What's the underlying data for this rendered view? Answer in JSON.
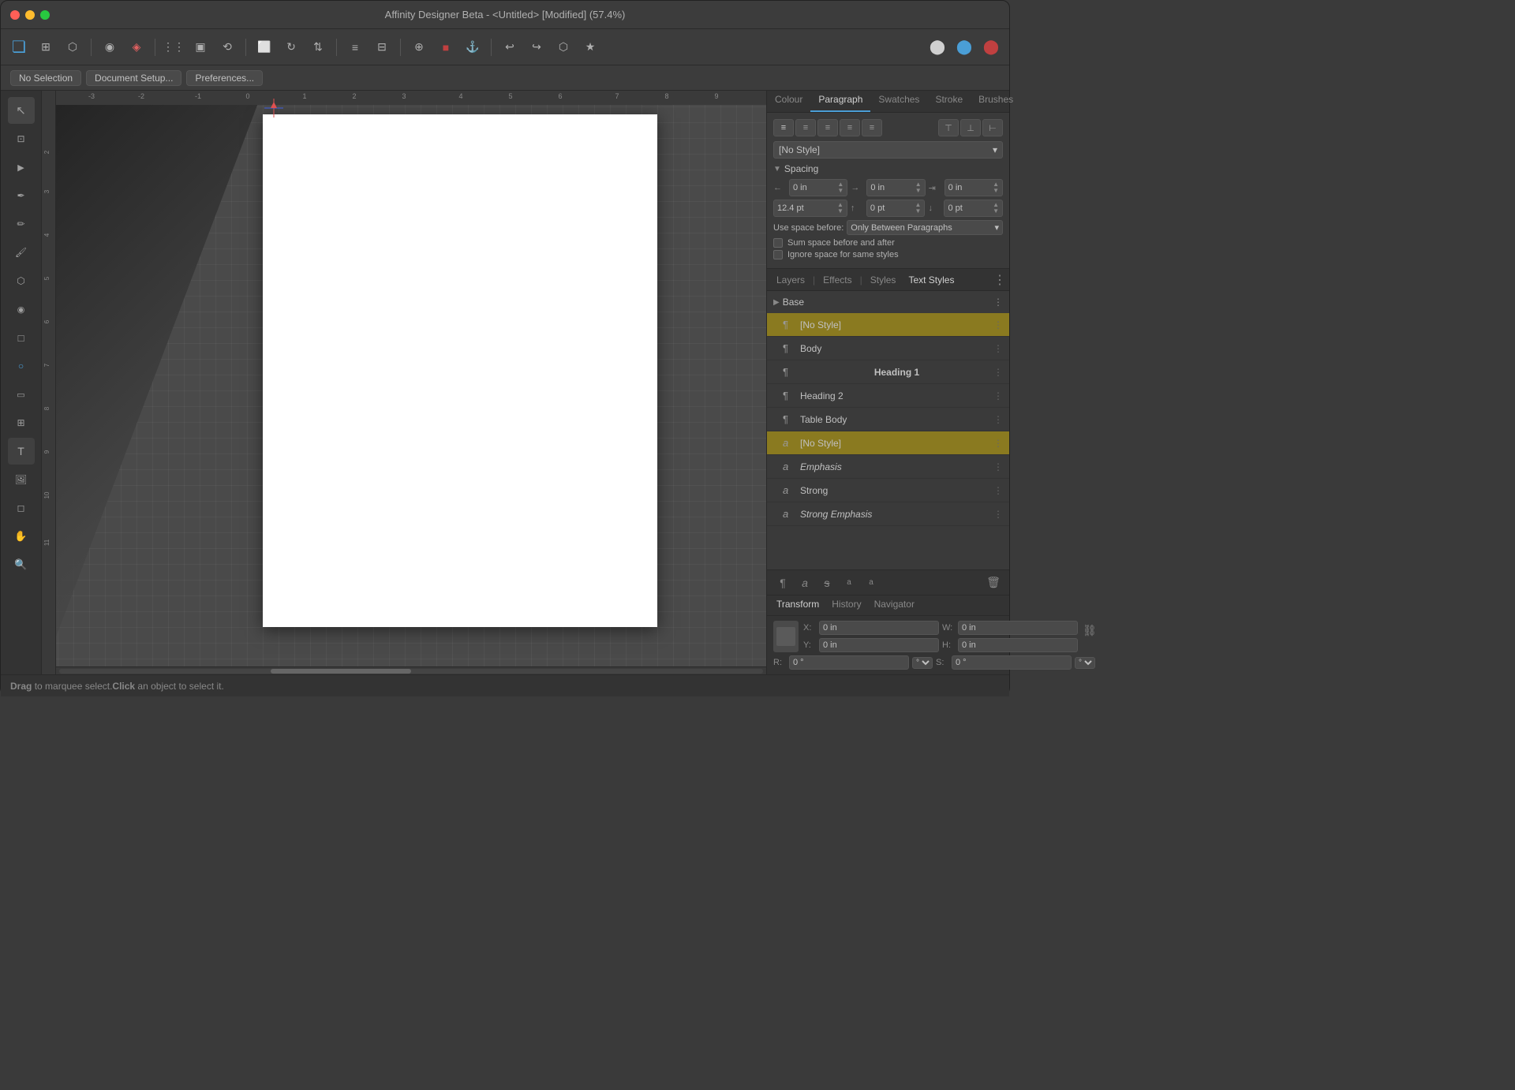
{
  "window": {
    "title": "Affinity Designer Beta - <Untitled> [Modified] (57.4%)"
  },
  "toolbar": {
    "tools": [
      {
        "name": "affinity-icon",
        "symbol": "▣",
        "color": "#4a9ed6"
      },
      {
        "name": "grid-icon",
        "symbol": "⊞"
      },
      {
        "name": "share-icon",
        "symbol": "⬡"
      },
      {
        "name": "sep1"
      },
      {
        "name": "web-icon",
        "symbol": "◉"
      },
      {
        "name": "brush-icon",
        "symbol": "✏"
      },
      {
        "name": "sep2"
      },
      {
        "name": "grid2-icon",
        "symbol": "⊟"
      },
      {
        "name": "select-icon",
        "symbol": "▣"
      },
      {
        "name": "transform-icon",
        "symbol": "⟲"
      },
      {
        "name": "sep3"
      },
      {
        "name": "crop-icon",
        "symbol": "⬜"
      },
      {
        "name": "rotate-icon",
        "symbol": "↻"
      },
      {
        "name": "sep4"
      },
      {
        "name": "pen-icon",
        "symbol": "✦"
      },
      {
        "name": "bezier-icon",
        "symbol": "∿"
      },
      {
        "name": "text-icon",
        "symbol": "T"
      },
      {
        "name": "sep5"
      },
      {
        "name": "fill-icon",
        "symbol": "▦"
      },
      {
        "name": "red-icon",
        "symbol": "⬛",
        "color": "#c04040"
      },
      {
        "name": "hook-icon",
        "symbol": "⚓",
        "color": "#d04040"
      },
      {
        "name": "sep6"
      },
      {
        "name": "undo-icon",
        "symbol": "↩"
      },
      {
        "name": "redo-icon",
        "symbol": "↪"
      },
      {
        "name": "arrange-icon",
        "symbol": "⬡"
      },
      {
        "name": "effects-icon",
        "symbol": "★"
      },
      {
        "name": "sep7"
      },
      {
        "name": "circle1-icon",
        "symbol": "⬤",
        "color": "#c0c0c0"
      },
      {
        "name": "circle2-icon",
        "symbol": "⬤",
        "color": "#4a9ed6"
      },
      {
        "name": "circle3-icon",
        "symbol": "⬤",
        "color": "#c04040"
      }
    ]
  },
  "optionbar": {
    "no_selection_label": "No Selection",
    "document_setup_label": "Document Setup...",
    "preferences_label": "Preferences..."
  },
  "panel_tabs": {
    "colour_label": "Colour",
    "paragraph_label": "Paragraph",
    "swatches_label": "Swatches",
    "stroke_label": "Stroke",
    "brushes_label": "Brushes"
  },
  "paragraph": {
    "style_dropdown": "[No Style]",
    "spacing_section": "Spacing",
    "spacing_expanded": true,
    "indent_left": "0 in",
    "indent_right": "0 in",
    "indent_first": "0 in",
    "line_height": "12.4 pt",
    "space_before": "0 pt",
    "space_after": "0 pt",
    "use_space_label": "Use space before:",
    "use_space_value": "Only Between Paragraphs",
    "sum_space_label": "Sum space before and after",
    "sum_space_checked": false,
    "ignore_space_label": "Ignore space for same styles"
  },
  "bottom_panel": {
    "layers_label": "Layers",
    "effects_label": "Effects",
    "styles_label": "Styles",
    "text_styles_label": "Text Styles",
    "active_tab": "Text Styles"
  },
  "text_styles": {
    "base_label": "Base",
    "para_styles": [
      {
        "id": "no-style-para",
        "label": "[No Style]",
        "active": true,
        "type": "para"
      },
      {
        "id": "body",
        "label": "Body",
        "active": false,
        "type": "para"
      },
      {
        "id": "heading1",
        "label": "Heading 1",
        "active": false,
        "type": "para",
        "bold": true
      },
      {
        "id": "heading2",
        "label": "Heading 2",
        "active": false,
        "type": "para"
      },
      {
        "id": "table-body",
        "label": "Table Body",
        "active": false,
        "type": "para"
      }
    ],
    "char_styles": [
      {
        "id": "no-style-char",
        "label": "[No Style]",
        "active": true,
        "type": "char"
      },
      {
        "id": "emphasis",
        "label": "Emphasis",
        "active": false,
        "type": "char",
        "italic": true
      },
      {
        "id": "strong",
        "label": "Strong",
        "active": false,
        "type": "char"
      },
      {
        "id": "strong-emphasis",
        "label": "Strong Emphasis",
        "active": false,
        "type": "char",
        "italic": true
      }
    ],
    "actions": {
      "para_add": "¶",
      "char_add": "a",
      "strikethrough": "s",
      "subscript": "₁",
      "superscript": "¹",
      "delete": "🗑"
    }
  },
  "transform": {
    "tab_label": "Transform",
    "history_label": "History",
    "navigator_label": "Navigator",
    "x_label": "X:",
    "x_value": "0 in",
    "y_label": "Y:",
    "y_value": "0 in",
    "w_label": "W:",
    "w_value": "0 in",
    "h_label": "H:",
    "h_value": "0 in",
    "r_label": "R:",
    "r_value": "0 °",
    "s_label": "S:",
    "s_value": "0 °"
  },
  "statusbar": {
    "message": "Drag to marquee select. Click an object to select it."
  },
  "left_tools": [
    {
      "name": "select-tool",
      "symbol": "↖"
    },
    {
      "name": "move-tool",
      "symbol": "⊡"
    },
    {
      "name": "node-tool",
      "symbol": "▶"
    },
    {
      "name": "pen-tool",
      "symbol": "✒"
    },
    {
      "name": "pencil-tool",
      "symbol": "✏"
    },
    {
      "name": "brush-tool",
      "symbol": "🖌"
    },
    {
      "name": "fill-tool",
      "symbol": "⬡"
    },
    {
      "name": "point-tool",
      "symbol": "◉"
    },
    {
      "name": "rect-tool",
      "symbol": "□"
    },
    {
      "name": "ellipse-tool",
      "symbol": "○"
    },
    {
      "name": "shape-tool",
      "symbol": "▭"
    },
    {
      "name": "crop-tool",
      "symbol": "⊞"
    },
    {
      "name": "text-frame-tool",
      "symbol": "T"
    },
    {
      "name": "image-tool",
      "symbol": "🖼"
    },
    {
      "name": "erase-tool",
      "symbol": "◻"
    },
    {
      "name": "hand-tool",
      "symbol": "✋"
    },
    {
      "name": "zoom-tool",
      "symbol": "🔍"
    }
  ],
  "ruler": {
    "labels": [
      "-3",
      "-2",
      "-1",
      "0",
      "1",
      "2",
      "3",
      "4",
      "5",
      "6",
      "7",
      "8",
      "9"
    ]
  }
}
